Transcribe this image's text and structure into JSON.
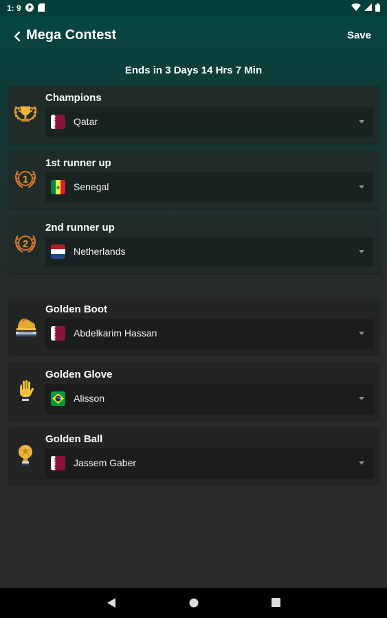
{
  "status_bar": {
    "time": "1: 9",
    "left_icons": [
      "p-circle-icon",
      "sd-card-icon"
    ],
    "right_icons": [
      "wifi-icon",
      "signal-icon",
      "battery-icon"
    ]
  },
  "header": {
    "title": "Mega Contest",
    "save_label": "Save",
    "back_icon": "chevron-left-icon"
  },
  "countdown": "Ends in 3 Days 14 Hrs 7 Min",
  "predictions": [
    {
      "title": "Champions",
      "icon": "trophy-icon",
      "value": "Qatar",
      "flag": "qatar"
    },
    {
      "title": "1st runner up",
      "icon": "laurel-1-icon",
      "value": "Senegal",
      "flag": "senegal"
    },
    {
      "title": "2nd runner up",
      "icon": "laurel-2-icon",
      "value": "Netherlands",
      "flag": "netherlands"
    }
  ],
  "awards": [
    {
      "title": "Golden Boot",
      "icon": "golden-boot-icon",
      "value": "Abdelkarim Hassan",
      "flag": "qatar"
    },
    {
      "title": "Golden Glove",
      "icon": "golden-glove-icon",
      "value": "Alisson",
      "flag": "brazil"
    },
    {
      "title": "Golden Ball",
      "icon": "golden-ball-icon",
      "value": "Jassem Gaber",
      "flag": "qatar"
    }
  ],
  "colors": {
    "accent_teal": "#044a44",
    "card_bg": "#1f2c2a",
    "gold": "#e8a33a",
    "bronze": "#d9772a"
  },
  "nav_bar": [
    "back-triangle-icon",
    "home-circle-icon",
    "recents-square-icon"
  ]
}
